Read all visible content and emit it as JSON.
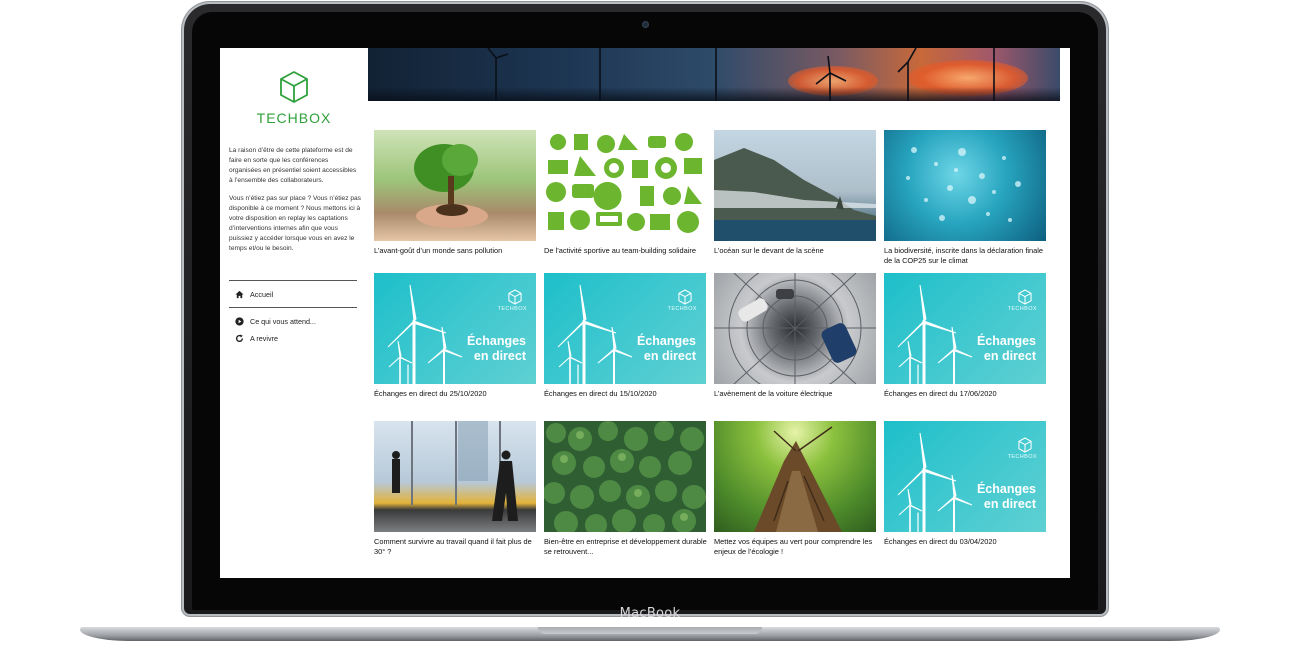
{
  "device": {
    "label": "MacBook"
  },
  "brand": {
    "name": "TECHBOX",
    "accent_color": "#2fa03a",
    "logo_icon": "cube-outline-icon"
  },
  "sidebar": {
    "intro_paragraph_1": "La raison d’être de cette plateforme est de faire en sorte que les conférences organisées en présentiel soient accessibles à l’ensemble des collaborateurs.",
    "intro_paragraph_2": "Vous n’étiez pas sur place ? Vous n’étiez pas disponible à ce moment ? Nous mettons ici à votre disposition en replay les captations d’interventions internes afin que vous puissiez y accéder lorsque vous en avez le temps et/ou le besoin.",
    "nav": [
      {
        "label": "Accueil",
        "icon": "home-icon"
      },
      {
        "label": "Ce qui vous attend...",
        "icon": "play-circle-icon"
      },
      {
        "label": "A revivre",
        "icon": "replay-icon"
      }
    ]
  },
  "live_tile": {
    "title_line_1": "Échanges",
    "title_line_2": "en direct",
    "brand": "TECHBOX",
    "color": "#1dbfc9"
  },
  "cards": [
    {
      "caption": "L’avant-goût d’un monde sans pollution"
    },
    {
      "caption": "De l’activité sportive au team-building solidaire"
    },
    {
      "caption": "L’océan sur le devant de la scène"
    },
    {
      "caption": "La biodiversité, inscrite dans la déclaration finale de la COP25 sur le climat"
    },
    {
      "caption": "Échanges en direct du 25/10/2020"
    },
    {
      "caption": "Échanges en direct du 15/10/2020"
    },
    {
      "caption": "L’avènement de la voiture électrique"
    },
    {
      "caption": "Échanges en direct du 17/06/2020"
    },
    {
      "caption": "Comment survivre au travail quand il fait plus de 30° ?"
    },
    {
      "caption": "Bien-être en entreprise et développement durable se retrouvent..."
    },
    {
      "caption": "Mettez vos équipes au vert pour comprendre les enjeux de l’écologie !"
    },
    {
      "caption": "Échanges en direct du 03/04/2020"
    }
  ]
}
